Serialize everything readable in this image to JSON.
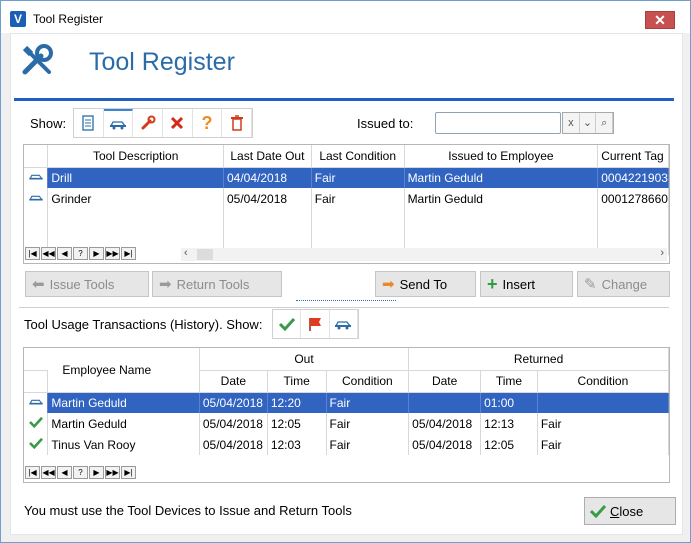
{
  "window": {
    "title": "Tool Register",
    "close_glyph": "✕",
    "app_icon_letter": "V"
  },
  "header": {
    "title": "Tool Register",
    "icon": "tools-icon"
  },
  "filters": {
    "show_label": "Show:",
    "buttons": [
      "document-icon",
      "car-icon",
      "wrench-icon",
      "red-x-icon",
      "question-icon",
      "trash-icon"
    ],
    "issued_to_label": "Issued to:",
    "issued_to_value": "",
    "clear_glyph": "x"
  },
  "tools_grid": {
    "columns": [
      "Tool Description",
      "Last Date Out",
      "Last Condition",
      "Issued to Employee",
      "Current Tag"
    ],
    "rows": [
      {
        "icon": "car-icon",
        "description": "Drill",
        "last_date_out": "04/04/2018",
        "last_condition": "Fair",
        "issued_to": "Martin Geduld",
        "current_tag": "0004221903"
      },
      {
        "icon": "car-icon",
        "description": "Grinder",
        "last_date_out": "05/04/2018",
        "last_condition": "Fair",
        "issued_to": "Martin Geduld",
        "current_tag": "0001278660"
      }
    ],
    "nav": [
      "|◀",
      "◀◀",
      "◀",
      "?",
      "▶",
      "▶▶",
      "▶|"
    ]
  },
  "actions": {
    "issue_tools": "Issue Tools",
    "return_tools": "Return Tools",
    "send_to": "Send To",
    "insert": "Insert",
    "change": "Change"
  },
  "history": {
    "label": "Tool Usage Transactions (History). Show:",
    "filter_buttons": [
      "check-icon",
      "flag-icon",
      "car-icon"
    ],
    "group_headers": {
      "out": "Out",
      "returned": "Returned"
    },
    "columns": {
      "employee": "Employee Name",
      "out_date": "Date",
      "out_time": "Time",
      "out_condition": "Condition",
      "ret_date": "Date",
      "ret_time": "Time",
      "ret_condition": "Condition"
    },
    "rows": [
      {
        "icon": "car-icon",
        "employee": "Martin Geduld",
        "out_date": "05/04/2018",
        "out_time": "12:20",
        "out_condition": "Fair",
        "ret_date": "",
        "ret_time": "01:00",
        "ret_condition": ""
      },
      {
        "icon": "check-icon",
        "employee": "Martin Geduld",
        "out_date": "05/04/2018",
        "out_time": "12:05",
        "out_condition": "Fair",
        "ret_date": "05/04/2018",
        "ret_time": "12:13",
        "ret_condition": "Fair"
      },
      {
        "icon": "check-icon",
        "employee": "Tinus Van Rooy",
        "out_date": "05/04/2018",
        "out_time": "12:03",
        "out_condition": "Fair",
        "ret_date": "05/04/2018",
        "ret_time": "12:05",
        "ret_condition": "Fair"
      }
    ],
    "nav": [
      "|◀",
      "◀◀",
      "◀",
      "?",
      "▶",
      "▶▶",
      "▶|"
    ]
  },
  "footer": {
    "message": "You must use the Tool Devices to Issue and Return Tools",
    "close_label_first": "C",
    "close_label_rest": "lose"
  },
  "colors": {
    "accent": "#1f5fbf",
    "selection": "#3163c0",
    "title": "#2b6ca8"
  }
}
